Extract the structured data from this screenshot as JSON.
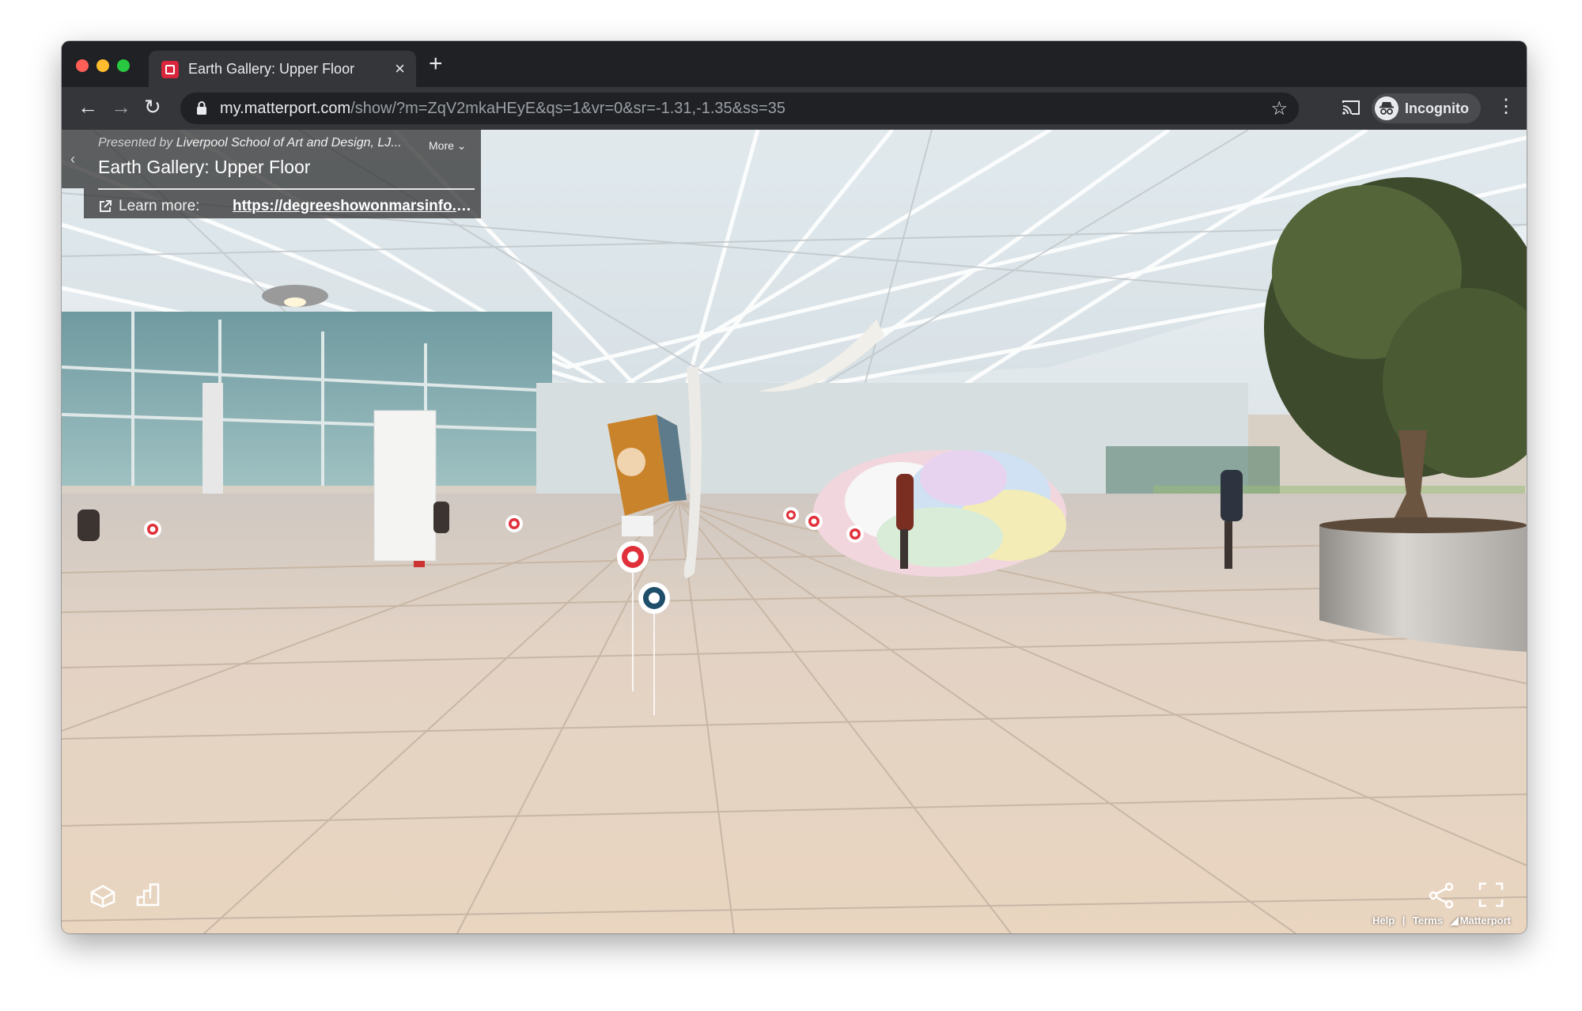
{
  "browser": {
    "tab_title": "Earth Gallery: Upper Floor",
    "tab_close": "×",
    "new_tab": "+",
    "url_host": "my.matterport.com",
    "url_path": "/show/?m=ZqV2mkaHEyE&qs=1&vr=0&sr=-1.31,-1.35&ss=35",
    "profile_label": "Incognito",
    "back": "←",
    "forward": "→",
    "reload": "↻",
    "star": "☆",
    "menu": "⋮"
  },
  "info_panel": {
    "presented_prefix": "Presented by",
    "presented_org": "Liverpool School of Art and Design, LJ...",
    "more_label": "More",
    "title": "Earth Gallery: Upper Floor",
    "learn_more_label": "Learn more:",
    "learn_more_link": "https://degreeshowonmarsinfo.co...",
    "collapse_glyph": "‹"
  },
  "footer": {
    "help": "Help",
    "terms": "Terms",
    "brand": "Matterport",
    "separator": "|"
  },
  "icons": {
    "dollhouse": "dollhouse-view-icon",
    "floorplan": "floorplan-view-icon",
    "share": "share-icon",
    "fullscreen": "fullscreen-icon"
  },
  "colors": {
    "tag_red": "#e0303a",
    "tag_navy": "#1f4e6b",
    "browser_dark": "#202124",
    "browser_toolbar": "#35363a"
  }
}
